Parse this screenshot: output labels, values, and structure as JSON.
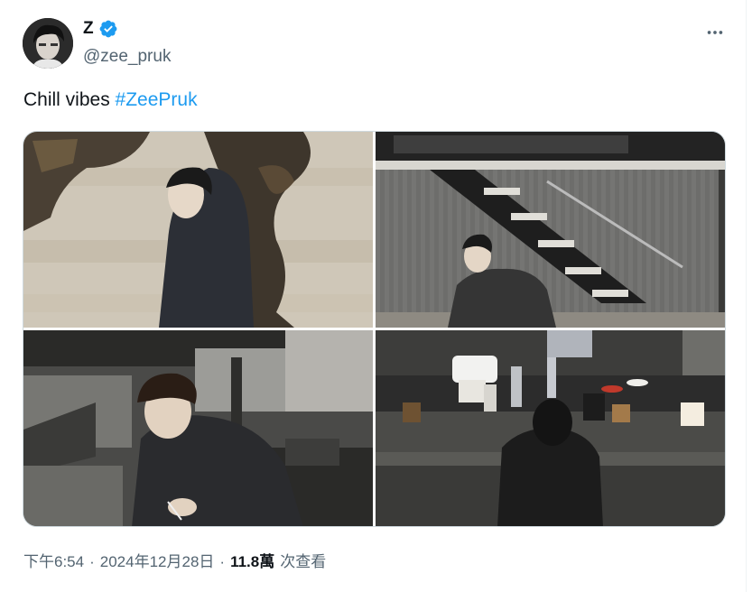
{
  "user": {
    "display_name": "Z",
    "handle": "@zee_pruk",
    "verified_icon": "verified-badge-icon",
    "avatar_icon": "avatar-photo"
  },
  "tweet": {
    "text": "Chill vibes",
    "hashtag": "#ZeePruk",
    "photos": [
      {
        "label": "photo-man-hoodie-cracked-wall"
      },
      {
        "label": "photo-man-window-stairs"
      },
      {
        "label": "photo-man-writing-table"
      },
      {
        "label": "photo-man-coffee-bar"
      }
    ]
  },
  "meta": {
    "time": "下午6:54",
    "sep1": "·",
    "date": "2024年12月28日",
    "sep2": "·",
    "views_count": "11.8萬",
    "views_label": "次查看"
  },
  "icons": {
    "more": "more-horizontal-icon"
  },
  "colors": {
    "accent": "#1d9bf0",
    "secondary_text": "#536471",
    "primary_text": "#0f1419"
  }
}
